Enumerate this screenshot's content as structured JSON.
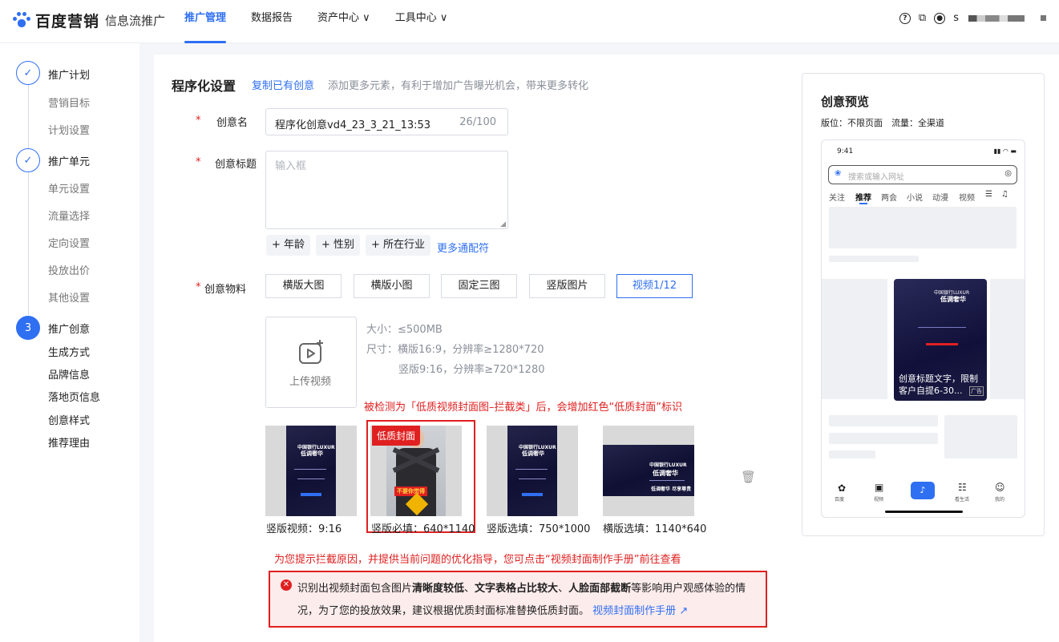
{
  "header": {
    "brand": "百度营销",
    "product": "信息流推广",
    "nav": [
      {
        "label": "推广管理",
        "active": true
      },
      {
        "label": "数据报告"
      },
      {
        "label": "资产中心 ∨"
      },
      {
        "label": "工具中心 ∨"
      }
    ],
    "user_initial": "s",
    "icons": [
      "help-icon",
      "copy-icon",
      "user-icon"
    ]
  },
  "steps": {
    "plan": {
      "title": "推广计划",
      "items": [
        "营销目标",
        "计划设置"
      ]
    },
    "unit": {
      "title": "推广单元",
      "items": [
        "单元设置",
        "流量选择",
        "定向设置",
        "投放出价",
        "其他设置"
      ]
    },
    "creative": {
      "number": "3",
      "title": "推广创意",
      "items": [
        "生成方式",
        "品牌信息",
        "落地页信息",
        "创意样式",
        "推荐理由"
      ]
    }
  },
  "form": {
    "section_title": "程序化设置",
    "copy_link": "复制已有创意",
    "section_hint": "添加更多元素，有利于增加广告曝光机会，带来更多转化",
    "name_label": "创意名",
    "name_value": "程序化创意vd4_23_3_21_13:53",
    "name_count": "26/100",
    "title_label": "创意标题",
    "title_placeholder": "输入框",
    "wildcards": [
      "+ 年龄",
      "+ 性别",
      "+ 所在行业"
    ],
    "more_wildcards": "更多通配符",
    "material_label": "创意物料",
    "material_tabs": [
      "横版大图",
      "横版小图",
      "固定三图",
      "竖版图片",
      "视频1/12"
    ],
    "upload_label": "上传视频",
    "specs": {
      "size": "大小：≤500MB",
      "dim1": "尺寸：横版16:9，分辨率≥1280*720",
      "dim2": "竖版9:16，分辨率≥720*1280"
    },
    "detect_note": "被检测为「低质视频封面图–拦截类」后，会增加红色“低质封面”标识",
    "low_quality_badge": "低质封面",
    "thumbs": [
      {
        "caption": "竖版视频：9:16"
      },
      {
        "caption": "竖版必填：640*1140"
      },
      {
        "caption": "竖版选填：750*1000"
      },
      {
        "caption": "横版选填：1140*640"
      }
    ],
    "poster_texts": {
      "brand": "中国银行LUXUR",
      "headline": "低调奢华",
      "sub": "低调奢华 尽享尊贵",
      "sticker": "不要你觉得"
    },
    "guide_note": "为您提示拦截原因，并提供当前问题的优化指导，您可点击“视频封面制作手册”前往查看",
    "alert": {
      "part1": "识别出视频封面包含图片",
      "b1": "清晰度较低",
      "sep1": "、",
      "b2": "文字表格占比较大",
      "sep2": "、",
      "b3": "人脸面部截断",
      "part2": "等影响用户观感体验的情",
      "line2": "况，为了您的投放效果，建议根据优质封面标准替换低质封面。",
      "link": "视频封面制作手册"
    }
  },
  "preview": {
    "title": "创意预览",
    "meta": "版位：不限页面　流量：全渠道",
    "time": "9:41",
    "search_placeholder": "搜索或输入网址",
    "tabs": [
      "关注",
      "推荐",
      "两会",
      "小说",
      "动漫",
      "视频"
    ],
    "card_title_line1": "创意标题文字，限制",
    "card_title_line2": "客户自提6-30...",
    "ad_tag": "广告",
    "bottom_nav": [
      "百度",
      "视频",
      "",
      "看生活",
      "我的"
    ]
  },
  "colors": {
    "accent": "#2f6ff2",
    "danger": "#e02020"
  }
}
